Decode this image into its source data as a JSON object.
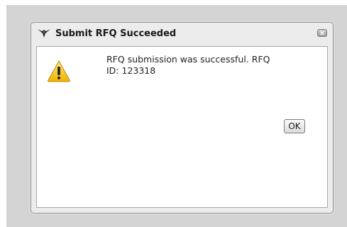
{
  "dialog": {
    "title": "Submit RFQ Succeeded",
    "message": "RFQ submission was successful. RFQ ID: 123318",
    "ok_label": "OK"
  },
  "icons": {
    "app": "app-logo-icon",
    "close": "close-icon",
    "status": "warning-icon"
  },
  "colors": {
    "warning_fill": "#f4c21f",
    "dialog_frame": "#ececec",
    "backdrop": "#d4d4d4"
  }
}
